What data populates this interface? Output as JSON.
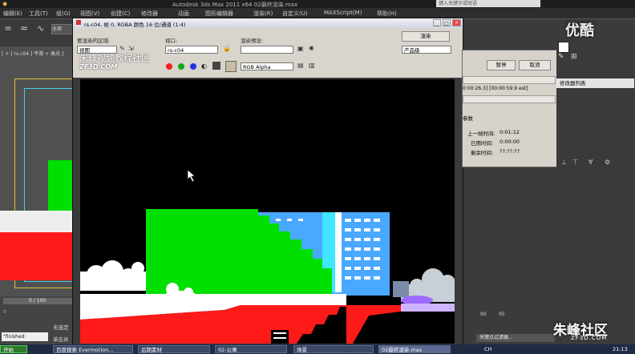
{
  "app": {
    "title": "Autodesk 3ds Max  2011 x64    02最终渲染.max",
    "search_placeholder": "键入关键字或短语"
  },
  "menu": [
    "编辑(E)",
    "工具(T)",
    "组(G)",
    "视图(V)",
    "创建(C)",
    "修改器",
    "动画",
    "图形编辑器",
    "渲染(R)",
    "自定义(U)",
    "MAXScript(M)",
    "帮助(H)"
  ],
  "left_viewport": {
    "label": "[ + ] rs-c04 ] 平滑 + 高光 ]",
    "timeline": "0 / 100",
    "status1": "未选定",
    "status2": "单击并",
    "script": "\"finished:"
  },
  "vfb": {
    "title": "rs-c04, 帧 0, RGBA 颜色 16 位/通道 (1:4)",
    "area_label": "要渲染的区域:",
    "area_value": "视图",
    "viewport_label": "视口:",
    "viewport_value": "rs-c04",
    "preset_label": "渲染预设:",
    "preset_value": "",
    "render_btn": "渲染",
    "quality_value": "产品级",
    "channel_value": "RGB Alpha",
    "watermark1": "朱峰视频教程社区",
    "watermark2": "ZF3D.COM"
  },
  "progress": {
    "pause_btn": "暂停",
    "cancel_btn": "取消",
    "time_line": "0:00:26.3] [00:00:59.9 est]",
    "section": "参数",
    "last_frame_label": "上一帧时间:",
    "last_frame_value": "0:01:12",
    "elapsed_label": "已用时间:",
    "elapsed_value": "0:00:00",
    "remaining_label": "剩余时间:",
    "remaining_value": "??:??:??"
  },
  "right_panel": {
    "modifier_list": "修改器列表",
    "frame_num": "95",
    "frame_num2": "90",
    "filter_label": "关键点过滤器..."
  },
  "taskbar": {
    "start": "开始",
    "items": [
      "百度搜索 Evermotion...",
      "后期素材",
      "02-公寓",
      "场景",
      "02最终渲染.max"
    ],
    "lang": "CH",
    "clock": "21:13"
  },
  "watermark": {
    "top_right": "优酷",
    "bottom_right": "朱峰社区",
    "bottom_right_url": "ZF3D.COM"
  },
  "colors": {
    "render_green": "#00e000",
    "render_red": "#ff1a1a",
    "building_blue": "#49a8ff",
    "building_cyan": "#3fe6ff"
  }
}
